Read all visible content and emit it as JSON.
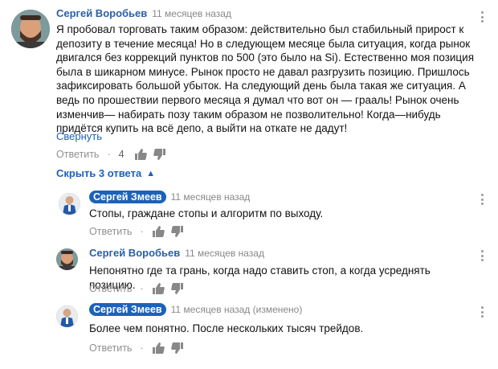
{
  "main_comment": {
    "author": "Сергей Воробьев",
    "time": "11 месяцев назад",
    "lines": [
      "Я пробовал торговать таким образом: действительно был стабильный прирост к",
      "депозиту в течение месяца! Но в следующем месяце была ситуация, когда рынок",
      "двигался без коррекций пунктов по 500 (это было на Si). Естественно моя позиция",
      "была в шикарном минусе. Рынок просто не давал разгрузить позицию. Пришлось",
      "зафиксировать большой убыток. На следующий день была такая же ситуация. А",
      "ведь по прошествии первого месяца я думал что вот он — грааль! Рынок очень",
      "изменчив— набирать позу таким образом не позволительно! Когда—нибудь",
      "придётся купить на всё депо, а выйти на откате не дадут!"
    ],
    "collapse_label": "Свернуть",
    "reply_label": "Ответить",
    "separator": "·",
    "likes": "4",
    "hide_replies_label": "Скрыть 3 ответа"
  },
  "replies": [
    {
      "author": "Сергей Змеев",
      "time": "11 месяцев назад",
      "text": "Стопы, граждане стопы и алгоритм по выходу.",
      "reply_label": "Ответить",
      "separator": "·"
    },
    {
      "author": "Сергей Воробьев",
      "time": "11 месяцев назад",
      "text": "Непонятно где та грань, когда надо ставить стоп, а когда усреднять позицию.",
      "reply_label": "Ответить",
      "separator": "·"
    },
    {
      "author": "Сергей Змеев",
      "time": "11 месяцев назад (изменено)",
      "text": "Более чем понятно. После нескольких тысяч трейдов.",
      "reply_label": "Ответить",
      "separator": "·"
    }
  ],
  "colors": {
    "link": "#1c62b9",
    "author_chip": "#1c62b9",
    "meta": "#888888"
  },
  "icons": [
    "thumb-up-icon",
    "thumb-down-icon",
    "more-vert-icon",
    "chevron-up-icon"
  ]
}
